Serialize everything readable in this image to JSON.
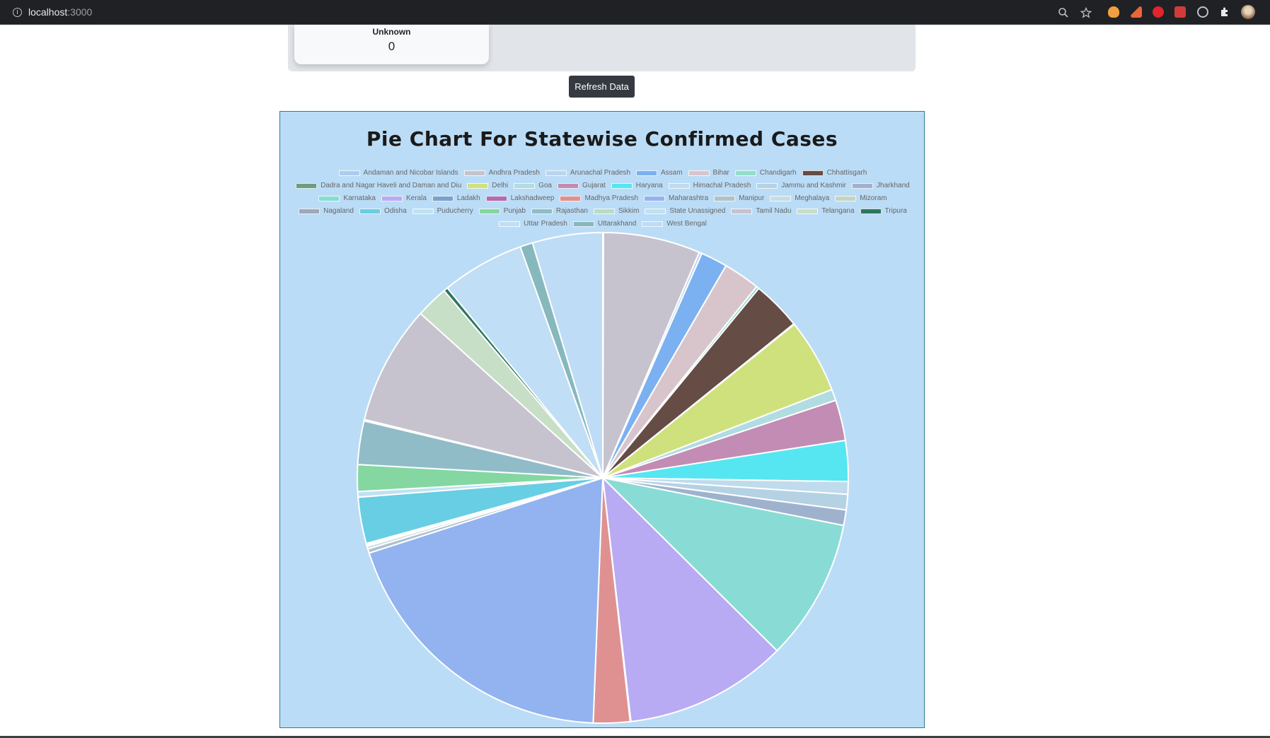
{
  "browser": {
    "url_host": "localhost",
    "url_port": ":3000"
  },
  "stat_card": {
    "label": "Unknown",
    "value": "0"
  },
  "refresh_button": "Refresh Data",
  "chart_data": {
    "type": "pie",
    "title": "Pie Chart For Statewise Confirmed Cases",
    "legend_position": "top",
    "slices": [
      {
        "name": "Andaman and Nicobar Islands",
        "value": 0.05,
        "color": "#aecbf0"
      },
      {
        "name": "Andhra Pradesh",
        "value": 6.9,
        "color": "#c6c3ce"
      },
      {
        "name": "Arunachal Pradesh",
        "value": 0.2,
        "color": "#bcd3f0"
      },
      {
        "name": "Assam",
        "value": 1.9,
        "color": "#7bb1f0"
      },
      {
        "name": "Bihar",
        "value": 2.6,
        "color": "#d8c5cb"
      },
      {
        "name": "Chandigarh",
        "value": 0.2,
        "color": "#93ddca"
      },
      {
        "name": "Chhattisgarh",
        "value": 3.5,
        "color": "#654c45"
      },
      {
        "name": "Dadra and Nagar Haveli and Daman and Diu",
        "value": 0.05,
        "color": "#6e9c7e"
      },
      {
        "name": "Delhi",
        "value": 5.3,
        "color": "#cfe17d"
      },
      {
        "name": "Goa",
        "value": 0.8,
        "color": "#b0dce2"
      },
      {
        "name": "Gujarat",
        "value": 2.9,
        "color": "#c28cb4"
      },
      {
        "name": "Haryana",
        "value": 2.9,
        "color": "#55e6f1"
      },
      {
        "name": "Himachal Pradesh",
        "value": 0.9,
        "color": "#bfdbed"
      },
      {
        "name": "Jammu and Kashmir",
        "value": 1.1,
        "color": "#b5d2e4"
      },
      {
        "name": "Jharkhand",
        "value": 1.1,
        "color": "#9fb2cd"
      },
      {
        "name": "Karnataka",
        "value": 10.1,
        "color": "#88dcd5"
      },
      {
        "name": "Kerala",
        "value": 11.6,
        "color": "#b8aaf3"
      },
      {
        "name": "Ladakh",
        "value": 0.05,
        "color": "#7aa2cb"
      },
      {
        "name": "Lakshadweep",
        "value": 0.0,
        "color": "#b06db0"
      },
      {
        "name": "Madhya Pradesh",
        "value": 2.6,
        "color": "#df9192"
      },
      {
        "name": "Maharashtra",
        "value": 21.0,
        "color": "#92b3f0"
      },
      {
        "name": "Manipur",
        "value": 0.3,
        "color": "#acc2cd"
      },
      {
        "name": "Meghalaya",
        "value": 0.2,
        "color": "#c4dde7"
      },
      {
        "name": "Mizoram",
        "value": 0.1,
        "color": "#c3d5c5"
      },
      {
        "name": "Nagaland",
        "value": 0.1,
        "color": "#9fa7ba"
      },
      {
        "name": "Odisha",
        "value": 3.3,
        "color": "#68cee4"
      },
      {
        "name": "Puducherry",
        "value": 0.4,
        "color": "#bfe2f2"
      },
      {
        "name": "Punjab",
        "value": 1.9,
        "color": "#84d7a0"
      },
      {
        "name": "Rajasthan",
        "value": 3.1,
        "color": "#90bcc8"
      },
      {
        "name": "Sikkim",
        "value": 0.05,
        "color": "#b9ddc3"
      },
      {
        "name": "State Unassigned",
        "value": 0.05,
        "color": "#bfe0f0"
      },
      {
        "name": "Tamil Nadu",
        "value": 8.5,
        "color": "#c6c3ce"
      },
      {
        "name": "Telangana",
        "value": 2.3,
        "color": "#c7dec7"
      },
      {
        "name": "Tripura",
        "value": 0.3,
        "color": "#2d7760"
      },
      {
        "name": "Uttar Pradesh",
        "value": 5.9,
        "color": "#c0def5"
      },
      {
        "name": "Uttarakhand",
        "value": 0.9,
        "color": "#86b8bd"
      },
      {
        "name": "West Bengal",
        "value": 5.0,
        "color": "#bfdcf6"
      }
    ]
  }
}
